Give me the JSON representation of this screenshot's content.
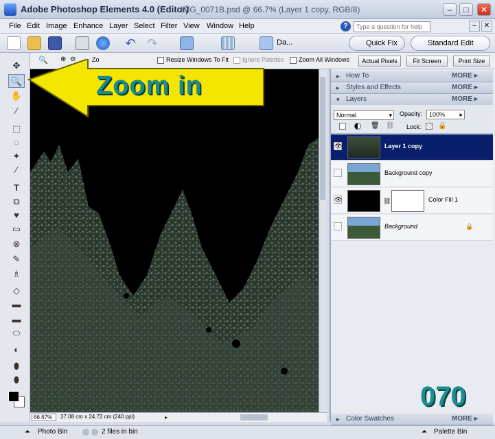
{
  "window": {
    "app_title": "Adobe Photoshop Elements 4.0 (Editor)",
    "doc_title": "IMG_0071B.psd @ 66.7% (Layer 1 copy, RGB/8)",
    "controls": [
      "–",
      "□",
      "✕"
    ]
  },
  "menu": {
    "items": [
      "File",
      "Edit",
      "Image",
      "Enhance",
      "Layer",
      "Select",
      "Filter",
      "View",
      "Window",
      "Help"
    ],
    "help_placeholder": "Type a question for help",
    "mdi_controls": [
      "–",
      "✕"
    ]
  },
  "toolbar": {
    "da_label": "Da...",
    "quick_fix": "Quick Fix",
    "standard_edit": "Standard Edit"
  },
  "options": {
    "zoom_label": "Zo",
    "resize_windows": "Resize Windows To Fit",
    "ignore_palettes": "Ignore Palettes",
    "zoom_all_windows": "Zoom All Windows",
    "actual_pixels": "Actual Pixels",
    "fit_screen": "Fit Screen",
    "print_size": "Print Size"
  },
  "tools": {
    "glyphs": [
      "✥",
      "🔍",
      "✋",
      "⁄",
      "⬚",
      "◌",
      "✦",
      "∕",
      "T",
      "⧉",
      "♥",
      "▭",
      "⊗",
      "✎",
      "♗",
      "◇",
      "▬",
      "⬭",
      "◐",
      "⬮"
    ]
  },
  "status": {
    "zoom": "66.67%",
    "dims": "37.08 cm x 24.72 cm (240 ppi)"
  },
  "palettes": {
    "more": "MORE ▸",
    "how_to": "How To",
    "styles": "Styles and Effects",
    "layers": "Layers",
    "swatches": "Color Swatches"
  },
  "layers_panel": {
    "blend_mode": "Normal",
    "opacity_label": "Opacity:",
    "opacity": "100%",
    "lock_label": "Lock:",
    "layers": [
      {
        "name": "Layer 1 copy",
        "visible": true,
        "selected": true
      },
      {
        "name": "Background copy",
        "visible": false,
        "selected": false
      },
      {
        "name": "Color Fill 1",
        "visible": true,
        "selected": false
      },
      {
        "name": "Background",
        "visible": false,
        "selected": false
      }
    ]
  },
  "bottom": {
    "photo_bin": "Photo Bin",
    "files": "2 files in bin",
    "palette_bin": "Palette Bin"
  },
  "overlay": {
    "callout": "Zoom in",
    "episode": "070"
  },
  "colors": {
    "selection": "#0a1f6b",
    "arrow": "#f4e600",
    "callout_text": "#1f8a8a"
  }
}
